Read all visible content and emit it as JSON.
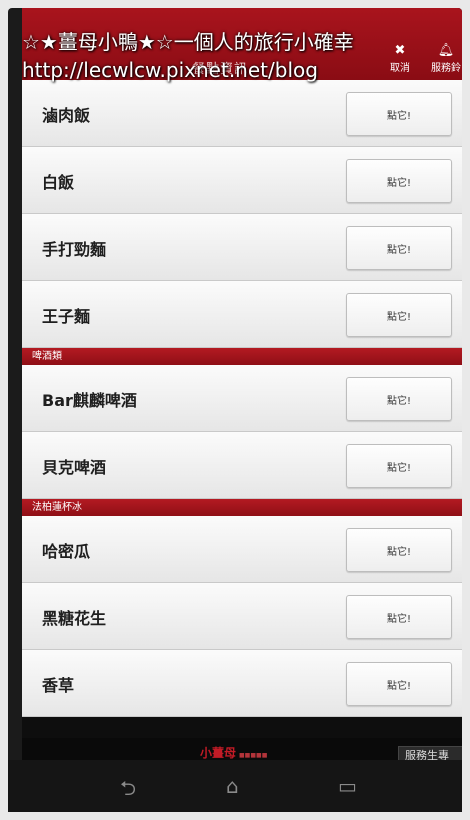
{
  "watermark": {
    "line1": "☆★薑母小鴨★☆一個人的旅行小確幸",
    "line2": "http://lecwlcw.pixnet.net/blog"
  },
  "topbar": {
    "title": "餐點資訊",
    "cancel_label": "取消",
    "service_label": "服務鈴"
  },
  "list": [
    {
      "type": "item",
      "name": "滷肉飯",
      "button": "點它!"
    },
    {
      "type": "item",
      "name": "白飯",
      "button": "點它!"
    },
    {
      "type": "item",
      "name": "手打勁麵",
      "button": "點它!"
    },
    {
      "type": "item",
      "name": "王子麵",
      "button": "點它!"
    },
    {
      "type": "section",
      "name": "啤酒類"
    },
    {
      "type": "item",
      "name": "Bar麒麟啤酒",
      "button": "點它!"
    },
    {
      "type": "item",
      "name": "貝克啤酒",
      "button": "點它!"
    },
    {
      "type": "section",
      "name": "法柏蓮杯冰"
    },
    {
      "type": "item",
      "name": "哈密瓜",
      "button": "點它!"
    },
    {
      "type": "item",
      "name": "黑糖花生",
      "button": "點它!"
    },
    {
      "type": "item",
      "name": "香草",
      "button": "點它!"
    }
  ],
  "footer": {
    "logo": "小薑母",
    "service_call": "服務生專"
  },
  "colors": {
    "brand_red": "#a9141d"
  },
  "icons": {
    "cancel": "close-icon",
    "service": "bell-icon",
    "back": "back-icon",
    "home": "home-icon",
    "recent": "recent-apps-icon"
  }
}
